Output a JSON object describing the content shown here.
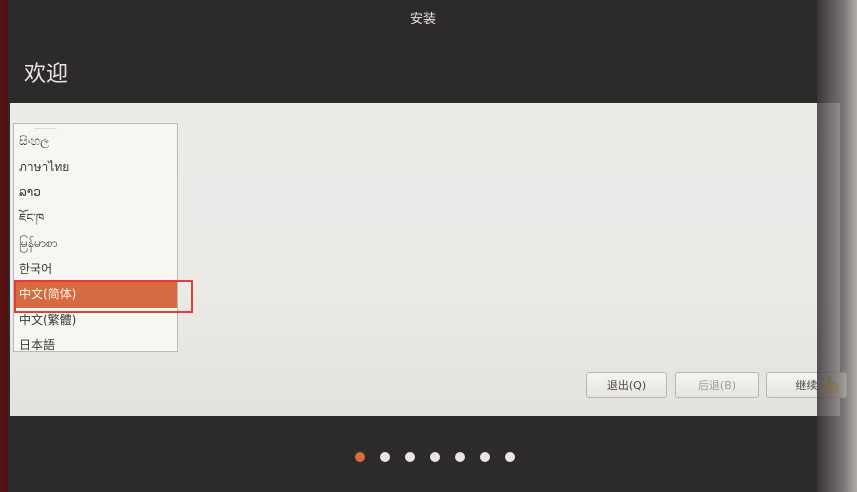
{
  "window": {
    "title": "安装",
    "heading": "欢迎"
  },
  "language_list": {
    "items": [
      {
        "label": "සිංහල"
      },
      {
        "label": "ภาษาไทย"
      },
      {
        "label": "ລາວ"
      },
      {
        "label": "ཇོང་ཁ"
      },
      {
        "label": "မြန်မာစာ"
      },
      {
        "label": "한국어"
      },
      {
        "label": "中文(简体)",
        "selected": true
      },
      {
        "label": "中文(繁體)"
      },
      {
        "label": "日本語"
      }
    ]
  },
  "buttons": {
    "quit": "退出(Q)",
    "back": "后退(B)",
    "continue": "继续"
  },
  "pager": {
    "total": 7,
    "active_index": 0
  },
  "colors": {
    "accent": "#dc6a3d",
    "selection": "#d66b42",
    "annotation": "#e83a3a"
  }
}
